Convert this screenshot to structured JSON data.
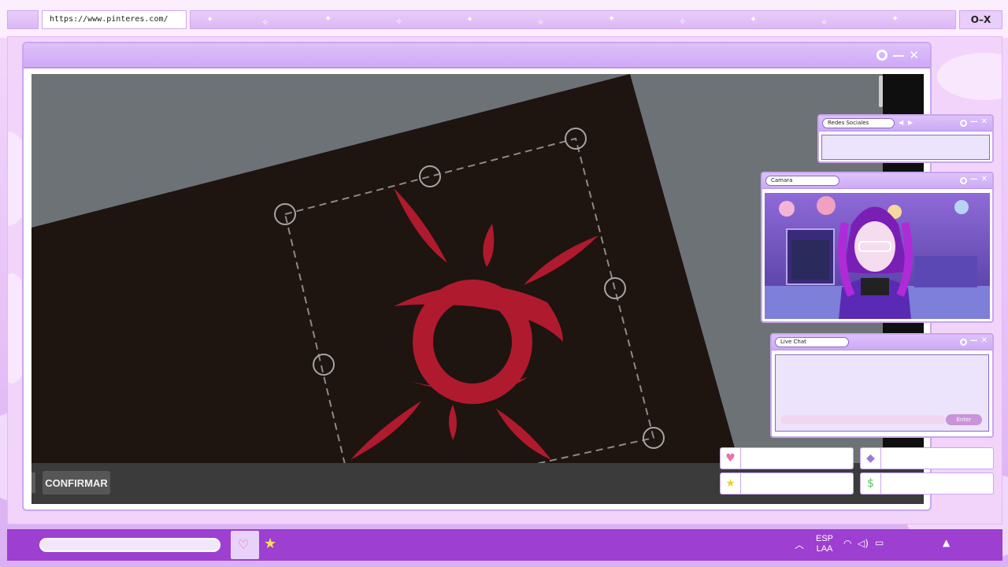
{
  "browser": {
    "url": "https://www.pinteres.com/",
    "window_controls": "O–X"
  },
  "main_window": {
    "controls": [
      "circle",
      "minimize",
      "close"
    ],
    "confirm_button": "CONFIRMAR"
  },
  "panels": {
    "social": {
      "title": "Redes Sociales"
    },
    "camera": {
      "title": "Camara"
    },
    "chat": {
      "title": "Live Chat",
      "send_label": "Enter"
    }
  },
  "social_tiles": [
    {
      "icon": "heart-icon",
      "color": "#f06fa8"
    },
    {
      "icon": "diamond-icon",
      "color": "#9b7ad8"
    },
    {
      "icon": "star-icon",
      "color": "#f3e25a"
    },
    {
      "icon": "money-icon",
      "color": "#5fc45b"
    }
  ],
  "taskbar": {
    "lang_primary": "ESP",
    "lang_secondary": "LAA"
  },
  "colors": {
    "accent": "#9d3fd1",
    "frame": "#c9a6ee",
    "symbol_red": "#b01a2e"
  }
}
